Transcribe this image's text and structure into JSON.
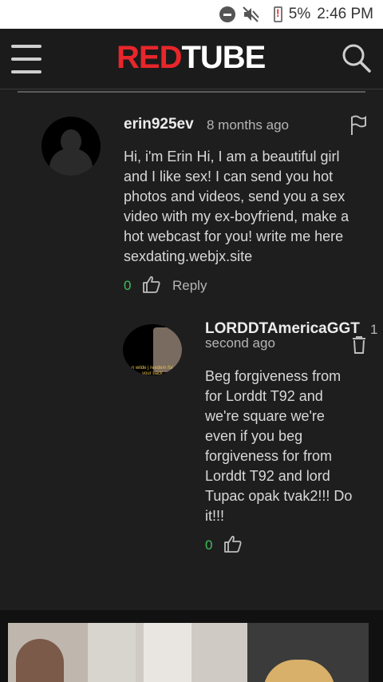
{
  "status_bar": {
    "battery_percent": "5%",
    "time": "2:46 PM",
    "icons": [
      "do-not-disturb-icon",
      "mute-icon",
      "battery-low-icon"
    ]
  },
  "header": {
    "logo_red": "RED",
    "logo_white": "TUBE",
    "icons": [
      "menu-icon",
      "search-icon"
    ]
  },
  "comments": [
    {
      "username": "erin925ev",
      "timestamp": "8 months ago",
      "text_lines": [
        "Hi, i'm Erin Hi, I am a beautiful girl",
        "and I like sex! I can send you hot",
        "photos and videos, send you a sex",
        "video with my ex-boyfriend, make a",
        "hot webcast for you! write me here",
        "sexdating.webjx.site"
      ],
      "likes": "0",
      "reply_label": "Reply",
      "icons": [
        "flag-icon",
        "thumbs-up-icon"
      ]
    },
    {
      "username": "LORDDTAmericaGGT",
      "timestamp_part1": "1",
      "timestamp_part2": "second ago",
      "avatar_caption": "n wilde j reedem for your back",
      "text_lines": [
        "Beg forgiveness from",
        "for Lorddt T92 and",
        "we're square we're",
        "even if you beg",
        "forgiveness for from",
        "Lorddt T92 and lord",
        "Tupac opak tvak2!!! Do",
        "it!!!"
      ],
      "likes": "0",
      "icons": [
        "trash-icon",
        "thumbs-up-icon"
      ]
    }
  ],
  "colors": {
    "brand_red": "#e8262b",
    "like_green": "#3fbf5a",
    "background": "#1e1e1e"
  }
}
